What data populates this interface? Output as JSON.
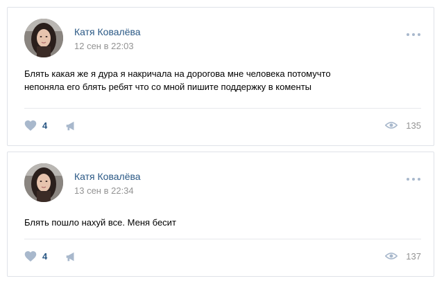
{
  "posts": [
    {
      "author": "Катя Ковалёва",
      "date": "12 сен в 22:03",
      "text": "Блять какая же я дура я накричала на дорогова мне человека потомучто\nнепоняла его блять ребят что со мной пишите поддержку в коменты",
      "likes": "4",
      "views": "135"
    },
    {
      "author": "Катя Ковалёва",
      "date": "13 сен в 22:34",
      "text": "Блять пошло нахуй все. Меня бесит",
      "likes": "4",
      "views": "137"
    }
  ],
  "icons": {
    "avatar": "avatar-photo",
    "more": "more-horizontal-icon",
    "like": "heart-icon",
    "share": "megaphone-icon",
    "views": "eye-icon"
  },
  "colors": {
    "link": "#2a5885",
    "muted": "#939393",
    "icon": "#a8b8cc",
    "border": "#dfe2e8"
  }
}
